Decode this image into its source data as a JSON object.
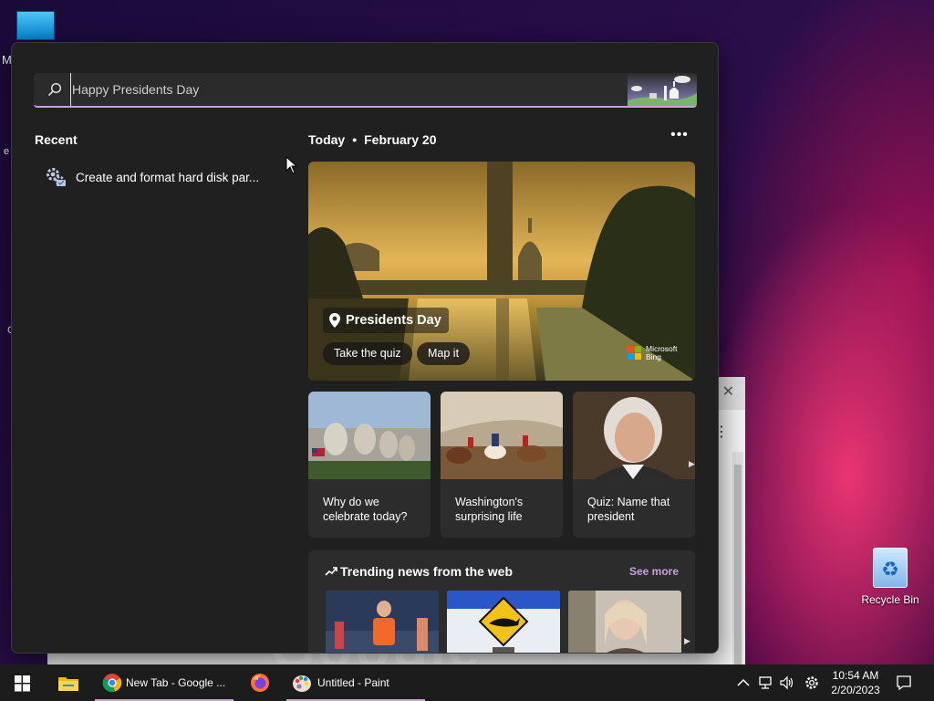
{
  "desktop": {
    "left_letter_1": "M",
    "left_letter_2": "e",
    "left_letter_3": "C",
    "recycle_bin_label": "Recycle Bin"
  },
  "search": {
    "value": "Happy Presidents Day",
    "icon": "search-icon"
  },
  "recent": {
    "title": "Recent",
    "items": [
      {
        "label": "Create and format hard disk par...",
        "icon": "settings-gear-icon"
      }
    ]
  },
  "today": {
    "label": "Today",
    "date": "February 20",
    "more_icon": "more-horizontal-icon"
  },
  "hero": {
    "title": "Presidents Day",
    "buttons": [
      "Take the quiz",
      "Map it"
    ],
    "brand": "Microsoft Bing",
    "brand_line1": "Microsoft",
    "brand_line2": "Bing"
  },
  "cards": [
    {
      "line1": "Why do we",
      "line2": "celebrate today?"
    },
    {
      "line1": "Washington's",
      "line2": "surprising life"
    },
    {
      "line1": "Quiz: Name that",
      "line2": "president"
    }
  ],
  "trending": {
    "title": "Trending news from the web",
    "see_more": "See more"
  },
  "background_window": {
    "logo_text": "Google"
  },
  "taskbar": {
    "items": [
      {
        "label": "",
        "icon": "file-explorer-icon"
      },
      {
        "label": "New Tab - Google ...",
        "icon": "chrome-icon"
      },
      {
        "label": "",
        "icon": "firefox-icon"
      },
      {
        "label": "Untitled - Paint",
        "icon": "paint-icon"
      }
    ],
    "clock_time": "10:54 AM",
    "clock_date": "2/20/2023"
  },
  "colors": {
    "accent": "#c9a0dc",
    "panel_bg": "#202020",
    "card_bg": "#2c2c2c",
    "taskbar_bg": "#1c1c1c"
  }
}
